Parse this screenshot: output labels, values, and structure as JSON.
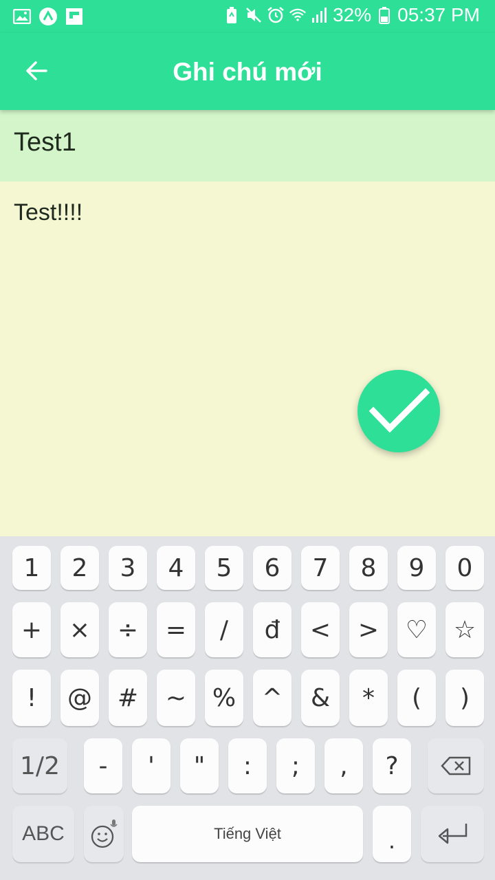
{
  "status_bar": {
    "battery": "32%",
    "time": "05:37 PM",
    "icons_left": [
      "image-icon",
      "app-icon",
      "flipboard-icon"
    ],
    "icons_right": [
      "battery-saver-icon",
      "mute-icon",
      "alarm-icon",
      "wifi-icon",
      "signal-icon",
      "battery-icon"
    ]
  },
  "app_bar": {
    "title": "Ghi chú mới",
    "back_icon": "arrow-left-icon"
  },
  "note": {
    "title": "Test1",
    "content": "Test!!!!"
  },
  "colors": {
    "accent": "#2ddf97",
    "title_bg": "#d3f5c9",
    "content_bg": "#f5f7d3"
  },
  "fab": {
    "icon": "check-icon"
  },
  "keyboard": {
    "row1": [
      "1",
      "2",
      "3",
      "4",
      "5",
      "6",
      "7",
      "8",
      "9",
      "0"
    ],
    "row2": [
      "+",
      "×",
      "÷",
      "=",
      "/",
      "đ",
      "<",
      ">",
      "♡",
      "☆"
    ],
    "row3": [
      "!",
      "@",
      "#",
      "~",
      "%",
      "^",
      "&",
      "*",
      "(",
      ")"
    ],
    "row4": [
      "-",
      "'",
      "\"",
      ":",
      ";",
      ",",
      "?"
    ],
    "shift_label": "1/2",
    "abc_label": "ABC",
    "space_label": "Tiếng Việt",
    "period_label": "."
  }
}
